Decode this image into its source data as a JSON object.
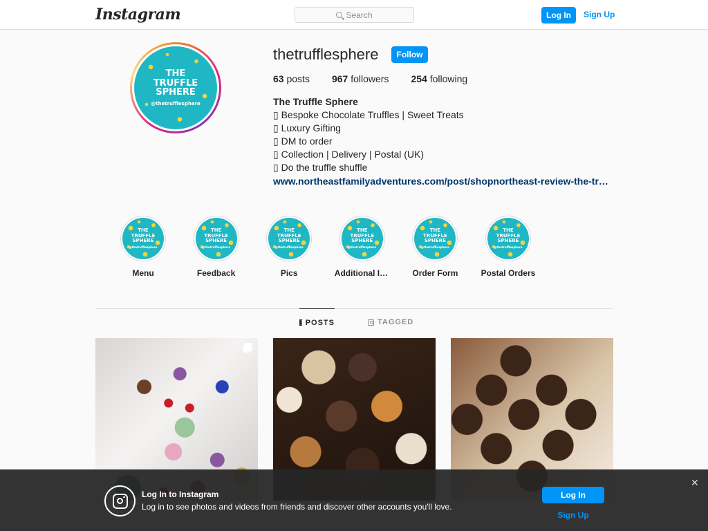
{
  "nav": {
    "logo": "Instagram",
    "search_placeholder": "Search",
    "login_label": "Log In",
    "signup_label": "Sign Up"
  },
  "profile": {
    "username": "thetrufflesphere",
    "follow_label": "Follow",
    "avatar_text": {
      "line1": "THE",
      "line2": "TRUFFLE",
      "line3": "SPHERE",
      "handle": "@thetrufflesphere"
    },
    "stats": {
      "posts_count": "63",
      "posts_label": "posts",
      "followers_count": "967",
      "followers_label": "followers",
      "following_count": "254",
      "following_label": "following"
    },
    "bio": {
      "name": "The Truffle Sphere",
      "lines": [
        "▯ Bespoke Chocolate Truffles | Sweet Treats",
        "▯ Luxury Gifting",
        "▯ DM to order",
        "▯ Collection | Delivery | Postal (UK)",
        "▯ Do the truffle shuffle"
      ],
      "link": "www.northeastfamilyadventures.com/post/shopnortheast-review-the-truffle-sphere"
    }
  },
  "highlights": [
    {
      "label": "Menu"
    },
    {
      "label": "Feedback"
    },
    {
      "label": "Pics"
    },
    {
      "label": "Additional Info"
    },
    {
      "label": "Order Form"
    },
    {
      "label": "Postal Orders"
    }
  ],
  "highlight_badge": {
    "line1": "THE",
    "line2": "TRUFFLE",
    "line3": "SPHERE",
    "handle": "@thetrufflesphere"
  },
  "tabs": {
    "posts_label": "POSTS",
    "tagged_label": "TAGGED"
  },
  "posts": [
    {
      "icon": "multiple-images-icon",
      "subject": "decorated chocolates number cake"
    },
    {
      "subject": "assorted truffles in box"
    },
    {
      "subject": "chocolate spheres with copper cross"
    }
  ],
  "banner": {
    "title": "Log In to Instagram",
    "text": "Log in to see photos and videos from friends and discover other accounts you'll love.",
    "login_label": "Log In",
    "signup_label": "Sign Up",
    "close_glyph": "✕"
  },
  "colors": {
    "accent": "#0095f6",
    "link": "#00376b",
    "badge": "#20b7c5"
  }
}
